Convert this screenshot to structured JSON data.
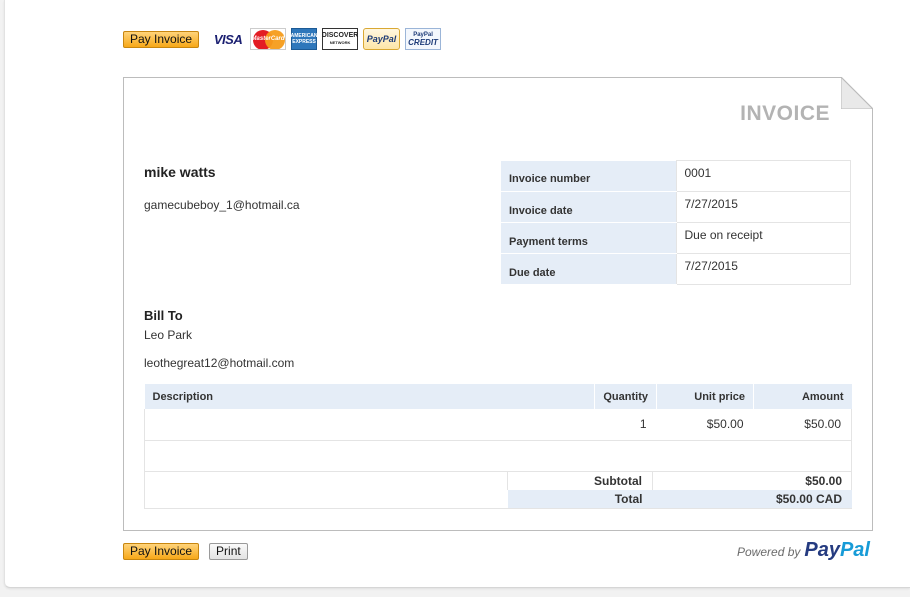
{
  "toolbar_top": {
    "pay_label": "Pay Invoice"
  },
  "payment_cards": {
    "visa": "VISA",
    "mastercard": "MasterCard",
    "amex": "AMERICAN EXPRESS",
    "discover": "DISCOVER",
    "discover_sub": "NETWORK",
    "paypal": "PayPal",
    "paypal_credit_top": "PayPal",
    "paypal_credit_bottom": "CREDIT"
  },
  "invoice": {
    "title": "INVOICE",
    "sender": {
      "name": "mike watts",
      "email": "gamecubeboy_1@hotmail.ca"
    },
    "meta": [
      {
        "label": "Invoice number",
        "value": "0001"
      },
      {
        "label": "Invoice date",
        "value": "7/27/2015"
      },
      {
        "label": "Payment terms",
        "value": "Due on receipt"
      },
      {
        "label": "Due date",
        "value": "7/27/2015"
      }
    ],
    "bill_to": {
      "label": "Bill To",
      "name": "Leo Park",
      "email": "leothegreat12@hotmail.com"
    },
    "columns": {
      "description": "Description",
      "quantity": "Quantity",
      "unit_price": "Unit price",
      "amount": "Amount"
    },
    "items": [
      {
        "description": "",
        "quantity": "1",
        "unit_price": "$50.00",
        "amount": "$50.00"
      }
    ],
    "subtotal_label": "Subtotal",
    "subtotal_value": "$50.00",
    "total_label": "Total",
    "total_value": "$50.00 CAD"
  },
  "toolbar_bottom": {
    "pay_label": "Pay Invoice",
    "print_label": "Print"
  },
  "footer": {
    "powered_by": "Powered by",
    "brand_part1": "Pay",
    "brand_part2": "Pal"
  },
  "colors": {
    "accent_blue": "#253b80",
    "accent_light_blue": "#179bd7",
    "pay_button": "#f7a818",
    "header_fill": "#e5edf7"
  }
}
